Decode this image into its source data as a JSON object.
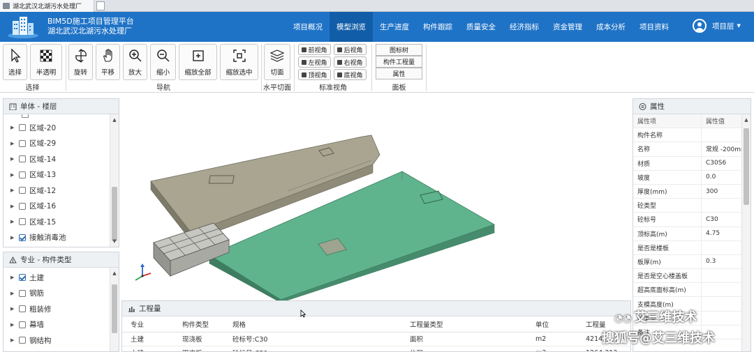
{
  "browser": {
    "tab_title": "湖北武汉北湖污水处理厂"
  },
  "header": {
    "line1": "BIM5D施工项目管理平台",
    "line2": "湖北武汉北湖污水处理厂",
    "nav": [
      "项目概况",
      "模型浏览",
      "生产进度",
      "构件跟踪",
      "质量安全",
      "经济指标",
      "资金管理",
      "成本分析",
      "项目资料"
    ],
    "active_nav": "模型浏览",
    "user_label": "项目层"
  },
  "ribbon": {
    "select_btn": "选择",
    "semi_btn": "半透明",
    "rotate_btn": "旋转",
    "pan_btn": "平移",
    "zoomin_btn": "放大",
    "zoomout_btn": "缩小",
    "zoomall_btn": "缩放全部",
    "zoomsel_btn": "缩放选中",
    "section_btn": "切面",
    "view_front": "前视角",
    "view_back": "后视角",
    "view_left": "左视角",
    "view_right": "右视角",
    "view_top": "顶视角",
    "view_bottom": "底视角",
    "panel_tree": "图标树",
    "panel_qty": "构件工程量",
    "panel_prop": "属性",
    "group_select": "选择",
    "group_nav": "导航",
    "group_section": "水平切面",
    "group_view": "标准视角",
    "group_panel": "面板"
  },
  "floors": {
    "title": "单体 - 楼层",
    "items": [
      {
        "label": "区域-20",
        "checked": false
      },
      {
        "label": "区域-29",
        "checked": false
      },
      {
        "label": "区域-14",
        "checked": false
      },
      {
        "label": "区域-13",
        "checked": false
      },
      {
        "label": "区域-12",
        "checked": false
      },
      {
        "label": "区域-16",
        "checked": false
      },
      {
        "label": "区域-15",
        "checked": false
      },
      {
        "label": "接触消毒池",
        "checked": true
      }
    ]
  },
  "types": {
    "title": "专业 - 构件类型",
    "items": [
      {
        "label": "土建",
        "checked": true
      },
      {
        "label": "钢筋",
        "checked": false
      },
      {
        "label": "粗装修",
        "checked": false
      },
      {
        "label": "幕墙",
        "checked": false
      },
      {
        "label": "钢结构",
        "checked": false
      }
    ]
  },
  "properties": {
    "title": "属性",
    "col_key": "属性项",
    "col_val": "属性值",
    "rows": [
      {
        "k": "构件名称",
        "v": ""
      },
      {
        "k": "名称",
        "v": "常规 -200mm"
      },
      {
        "k": "材质",
        "v": "C30S6"
      },
      {
        "k": "坡度",
        "v": "0.0"
      },
      {
        "k": "厚度(mm)",
        "v": "300"
      },
      {
        "k": "砼类型",
        "v": ""
      },
      {
        "k": "砼标号",
        "v": "C30"
      },
      {
        "k": "顶标高(m)",
        "v": "4.75"
      },
      {
        "k": "是否是楼板",
        "v": ""
      },
      {
        "k": "板厚(m)",
        "v": "0.3"
      },
      {
        "k": "是否是空心楼盖板",
        "v": ""
      },
      {
        "k": "超高底面标高(m)",
        "v": ""
      },
      {
        "k": "支模高度(m)",
        "v": ""
      },
      {
        "k": "砼类型",
        "v": ""
      },
      {
        "k": "备注",
        "v": ""
      }
    ]
  },
  "quantities": {
    "title": "工程量",
    "headers": [
      "专业",
      "构件类型",
      "规格",
      "工程量类型",
      "单位",
      "工程量"
    ],
    "rows": [
      [
        "土建",
        "现浇板",
        "砼标号:C30",
        "面积",
        "m2",
        "4214"
      ],
      [
        "土建",
        "现浇板",
        "砼标号:C30",
        "体积",
        "m3",
        "1264.313"
      ]
    ]
  },
  "watermark": {
    "top": "艾三维技术",
    "bottom": "搜狐号@艾三维技术"
  },
  "colors": {
    "header": "#1f73c7",
    "nav_active": "#125da8",
    "slab_green": "#5fb48d",
    "slab_gray": "#a5a18f"
  }
}
